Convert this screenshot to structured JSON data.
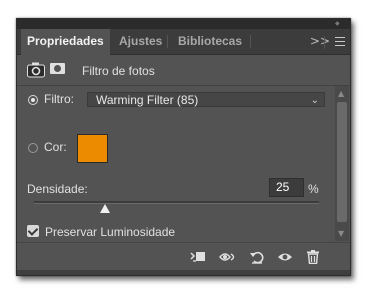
{
  "tabs": [
    {
      "label": "Propriedades",
      "active": true
    },
    {
      "label": "Ajustes",
      "active": false
    },
    {
      "label": "Bibliotecas",
      "active": false
    }
  ],
  "panel_header": {
    "icons": [
      "camera-adjustment-icon",
      "mask-icon"
    ],
    "title": "Filtro de fotos"
  },
  "filter": {
    "label": "Filtro:",
    "selected": "Warming Filter (85)",
    "checked": true
  },
  "color": {
    "label": "Cor:",
    "swatch": "#ec8a00",
    "checked": false
  },
  "density": {
    "label": "Densidade:",
    "value": "25",
    "unit": "%",
    "level": 0.25
  },
  "preserve_luminosity": {
    "label": "Preservar Luminosidade",
    "checked": true
  },
  "footer_icons": [
    "clip-to-layer-icon",
    "view-previous-state-icon",
    "reset-icon",
    "visibility-eye-icon",
    "trash-icon"
  ],
  "colors": {
    "panel_bg": "#535353",
    "tabbar_bg": "#3c3c3c",
    "text": "#e0e0e0",
    "accent_swatch": "#ec8a00"
  }
}
